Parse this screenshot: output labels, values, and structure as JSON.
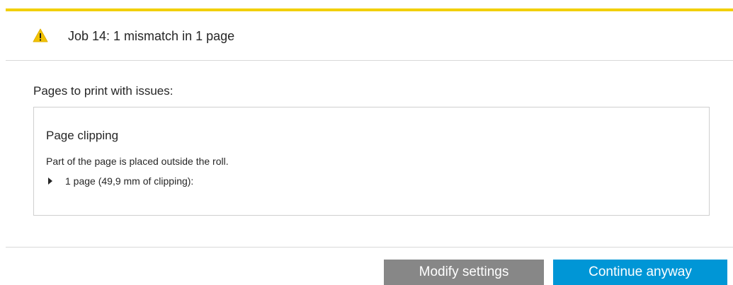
{
  "dialog": {
    "accent_color": "#f2cf00",
    "header": {
      "icon": "warning-icon",
      "icon_color": "#f2c200",
      "title": "Job 14: 1 mismatch in 1 page"
    },
    "section_label": "Pages to print with issues:",
    "issue": {
      "title": "Page clipping",
      "description": "Part of the page is placed outside the roll.",
      "detail": {
        "icon": "caret-right-icon",
        "text": "1 page (49,9 mm of clipping):",
        "expanded": false
      }
    },
    "buttons": {
      "modify_label": "Modify settings",
      "modify_color": "#878787",
      "continue_label": "Continue anyway",
      "continue_color": "#0096d6"
    }
  }
}
